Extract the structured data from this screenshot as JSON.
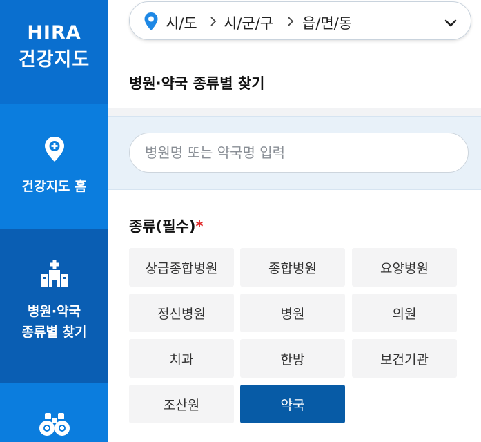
{
  "sidebar": {
    "logo_line1": "HIRA",
    "logo_line2": "건강지도",
    "items": [
      {
        "label": "건강지도 홈",
        "icon": "map-pin-icon"
      },
      {
        "label_line1": "병원·약국",
        "label_line2": "종류별 찾기",
        "icon": "hospital-icon",
        "active": true
      },
      {
        "label": "",
        "icon": "binoculars-icon"
      }
    ],
    "colors": {
      "bg": "#0b7dde",
      "logo_bg": "#0a6fcf",
      "active_bg": "#0a5eb3"
    }
  },
  "region": {
    "sido": "시/도",
    "sigungu": "시/군/구",
    "eupmyeondong": "읍/면/동",
    "pin_color": "#1e88e5"
  },
  "page": {
    "title": "병원·약국 종류별 찾기"
  },
  "search": {
    "placeholder": "병원명 또는 약국명 입력"
  },
  "kind": {
    "label": "종류(필수)",
    "required_mark": "*",
    "options": [
      "상급종합병원",
      "종합병원",
      "요양병원",
      "정신병원",
      "병원",
      "의원",
      "치과",
      "한방",
      "보건기관",
      "조산원",
      "약국"
    ],
    "selected": "약국",
    "active_color": "#075ba6"
  }
}
